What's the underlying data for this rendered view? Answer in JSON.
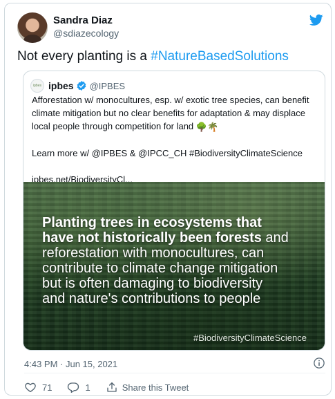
{
  "tweet": {
    "author": {
      "name": "Sandra Diaz",
      "handle": "@sdiazecology"
    },
    "text_prefix": "Not every planting is a ",
    "hashtag": "#NatureBasedSolutions",
    "timestamp": "4:43 PM · Jun 15, 2021",
    "accent_color": "#1d9bf0"
  },
  "quoted": {
    "avatar_text": "ipbes",
    "name": "ipbes",
    "handle": "@IPBES",
    "lines": [
      "Afforestation w/ monocultures, esp. w/ exotic tree species, can benefit",
      "climate mitigation but no clear benefits for adaptation & may displace",
      "local people through competition for land "
    ],
    "emoji": "🌳🌴",
    "learn_more": "Learn more w/ @IPBES & @IPCC_CH #BiodiversityClimateScience",
    "link": "ipbes.net/BiodiversityCl...",
    "image": {
      "bold_lines": [
        "Planting trees in ecosystems that",
        "have not historically been forests"
      ],
      "tail_first": " and",
      "rest_lines": [
        "reforestation with monocultures, can",
        "contribute to climate change mitigation",
        "but is often damaging to biodiversity",
        "and nature's contributions to people"
      ],
      "hashtag": "#BiodiversityClimateScience"
    }
  },
  "actions": {
    "like_count": "71",
    "reply_count": "1",
    "share_label": "Share this Tweet"
  }
}
